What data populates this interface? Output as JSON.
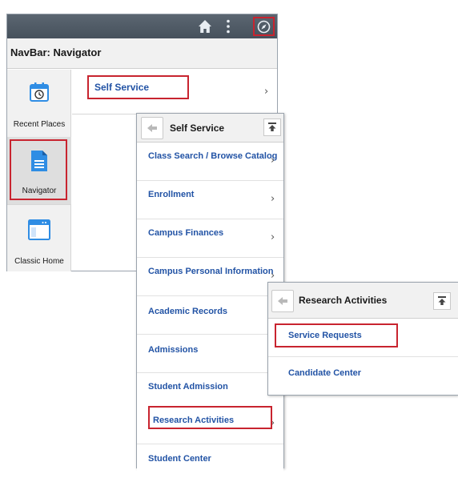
{
  "navbar": {
    "title": "NavBar: Navigator",
    "top_icons": [
      "home-icon",
      "kebab-menu-icon",
      "navigator-icon"
    ],
    "side_tiles": [
      {
        "label": "Recent Places",
        "icon": "calendar-clock-icon"
      },
      {
        "label": "Navigator",
        "icon": "document-icon"
      },
      {
        "label": "Classic Home",
        "icon": "window-icon"
      }
    ],
    "menu_item": {
      "label": "Self Service",
      "chevron": "›"
    }
  },
  "self_service_panel": {
    "title": "Self Service",
    "items": [
      {
        "label": "Class Search / Browse Catalog",
        "chevron": "›"
      },
      {
        "label": "Enrollment",
        "chevron": "›"
      },
      {
        "label": "Campus Finances",
        "chevron": "›"
      },
      {
        "label": "Campus Personal Information",
        "chevron": "›"
      },
      {
        "label": "Academic Records",
        "chevron": ""
      },
      {
        "label": "Admissions",
        "chevron": ""
      },
      {
        "label": "Student Admission",
        "chevron": ""
      },
      {
        "label": "Research Activities",
        "chevron": "›"
      },
      {
        "label": "Student Center",
        "chevron": ""
      }
    ]
  },
  "research_panel": {
    "title": "Research Activities",
    "items": [
      {
        "label": "Service Requests"
      },
      {
        "label": "Candidate Center"
      }
    ]
  },
  "colors": {
    "topbar": "#4f5a66",
    "link": "#2253a5",
    "highlight": "#c8242f",
    "icon_blue": "#2f8de4"
  }
}
